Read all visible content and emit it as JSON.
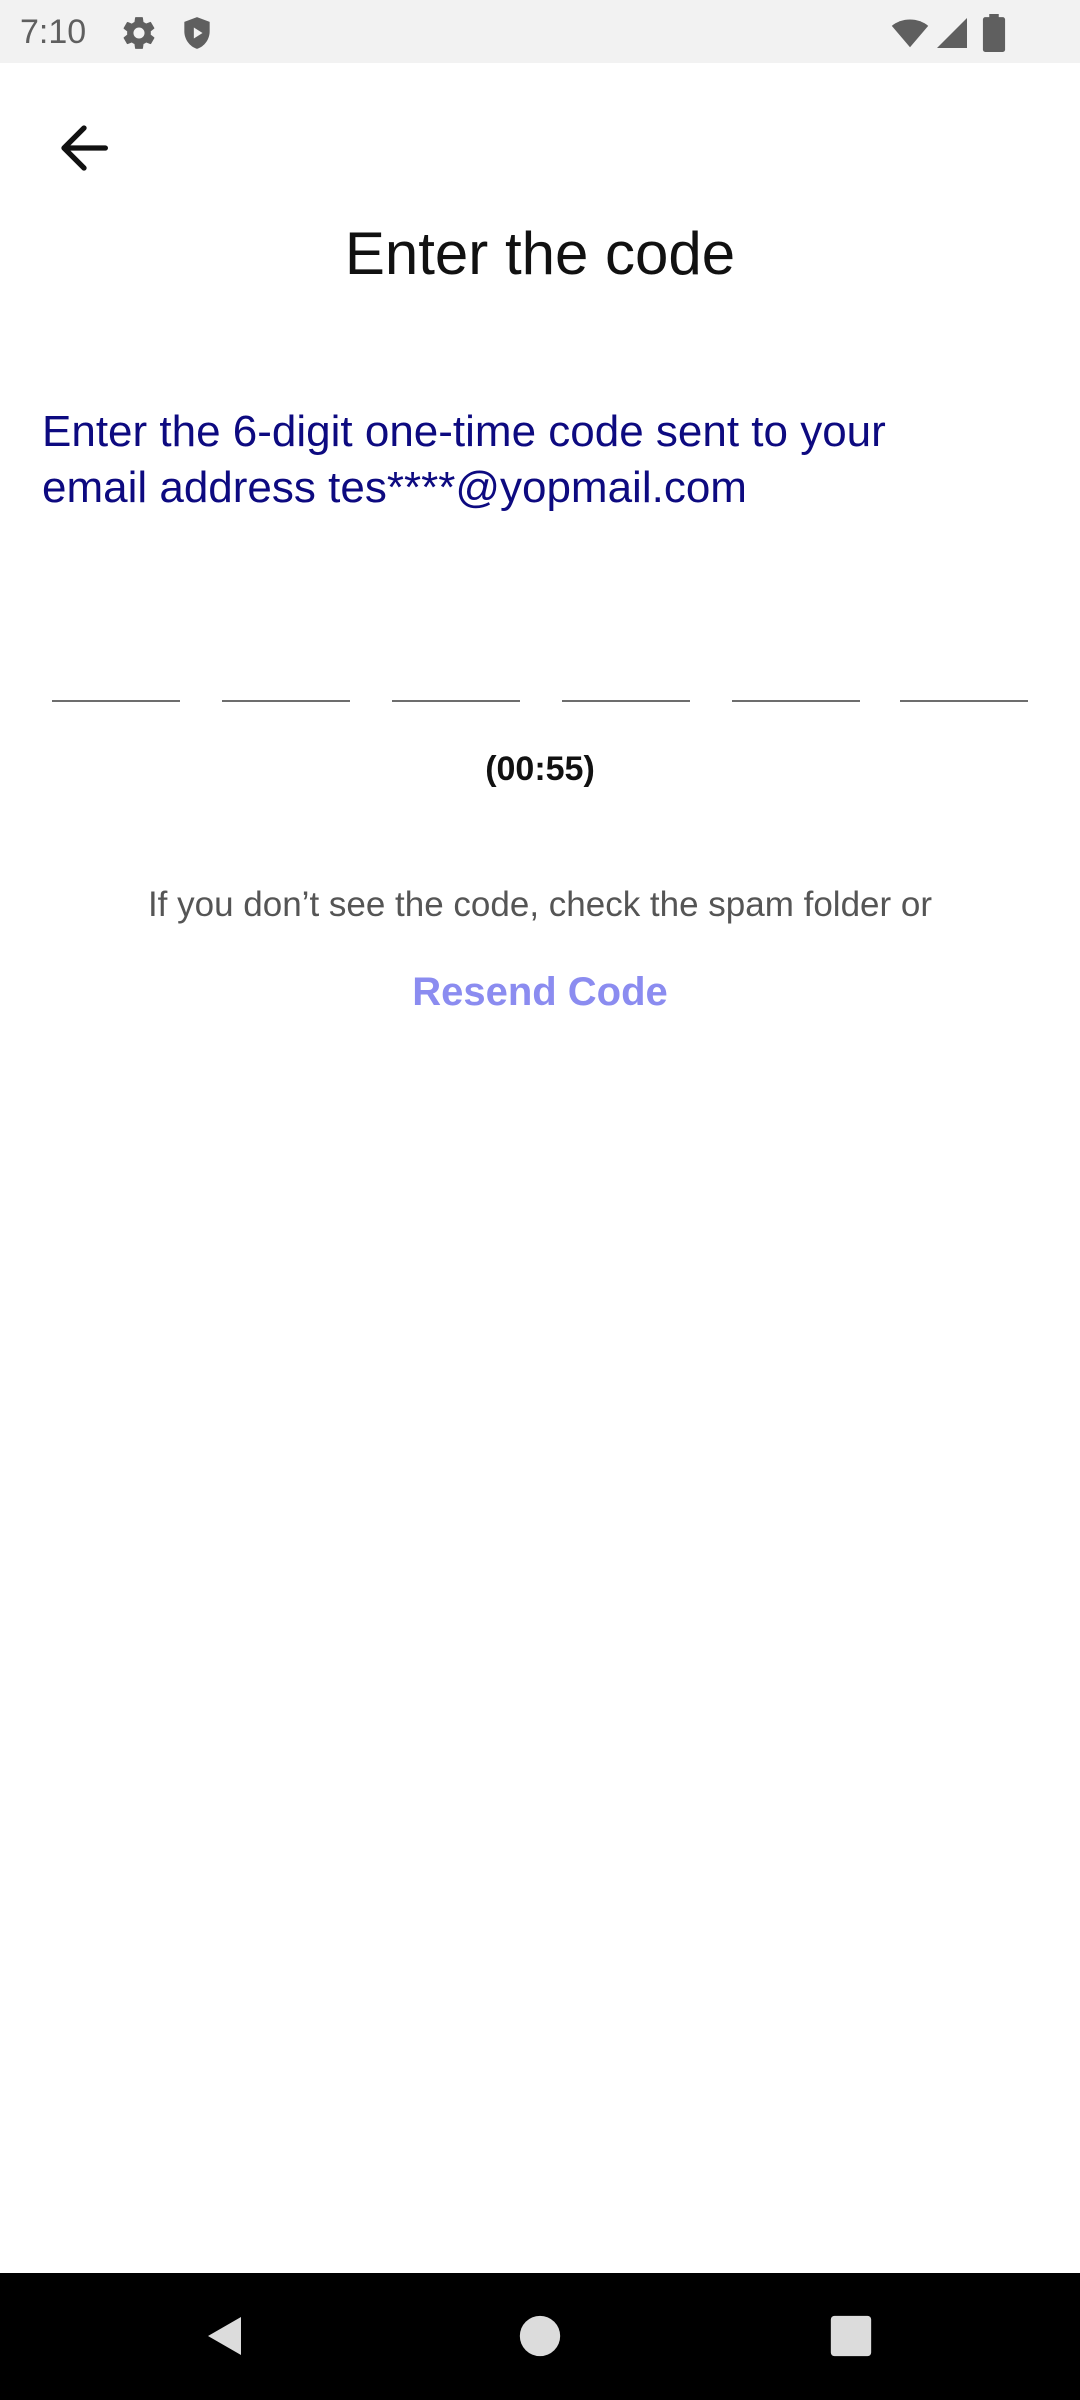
{
  "status_bar": {
    "time": "7:10",
    "left_icons": [
      "settings-icon",
      "shield-icon"
    ],
    "right_icons": [
      "wifi-icon",
      "signal-icon",
      "battery-icon"
    ]
  },
  "app_bar": {
    "back_icon": "arrow-back-icon"
  },
  "page": {
    "title": "Enter the code",
    "instructions_line1": "Enter the 6-digit one-time code sent to your",
    "instructions_line2": "email address tes****@yopmail.com",
    "code_length": 6,
    "code_values": [
      "",
      "",
      "",
      "",
      "",
      ""
    ],
    "timer": "(00:55)",
    "spam_hint": "If you don’t see the code, check the spam folder or",
    "resend_label": "Resend Code"
  },
  "colors": {
    "instructions_text": "#0d0a80",
    "resend_link": "#8b8cf0",
    "status_bar_bg": "#f2f2f2",
    "nav_bar_bg": "#000000"
  },
  "nav_bar": {
    "icons": [
      "back-triangle-icon",
      "home-circle-icon",
      "recents-square-icon"
    ]
  }
}
